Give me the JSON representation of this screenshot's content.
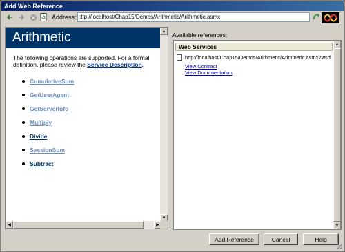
{
  "window": {
    "title": "Add Web Reference"
  },
  "toolbar": {
    "back_icon": "back-arrow-icon",
    "forward_icon": "forward-arrow-icon",
    "stop_icon": "stop-icon",
    "refresh_icon": "refresh-page-icon",
    "address_label": "Address:",
    "address_value": ":ttp://localhost/Chap15/Demos/Arithmetic/Arithmetic.asmx",
    "go_icon": "go-arrow-icon",
    "logo_icon": "dotnet-logo-icon"
  },
  "service": {
    "name": "Arithmetic",
    "intro_prefix": "The following operations are supported. For a formal definition, please review the ",
    "intro_link": "Service Description",
    "intro_suffix": ".",
    "operations": [
      {
        "label": "CumulativeSum",
        "visited": true
      },
      {
        "label": "GetUserAgent",
        "visited": true
      },
      {
        "label": "GetServerInfo",
        "visited": true
      },
      {
        "label": "Multiply",
        "visited": true
      },
      {
        "label": "Divide",
        "visited": false
      },
      {
        "label": "SessionSum",
        "visited": true
      },
      {
        "label": "Subtract",
        "visited": false
      }
    ]
  },
  "references": {
    "label": "Available references:",
    "section_title": "Web Services",
    "url": "http://localhost/Chap15/Demos/Arithmetic/Arithmetic.asmx?wsdl",
    "view_contract": "View Contract",
    "view_documentation": "View Documentation"
  },
  "buttons": {
    "add_reference": "Add Reference",
    "cancel": "Cancel",
    "help": "Help"
  },
  "colors": {
    "header_bg": "#003366",
    "visited_link": "#6a8fbf",
    "unvisited_link": "#003366",
    "link_blue": "#0000cc"
  }
}
